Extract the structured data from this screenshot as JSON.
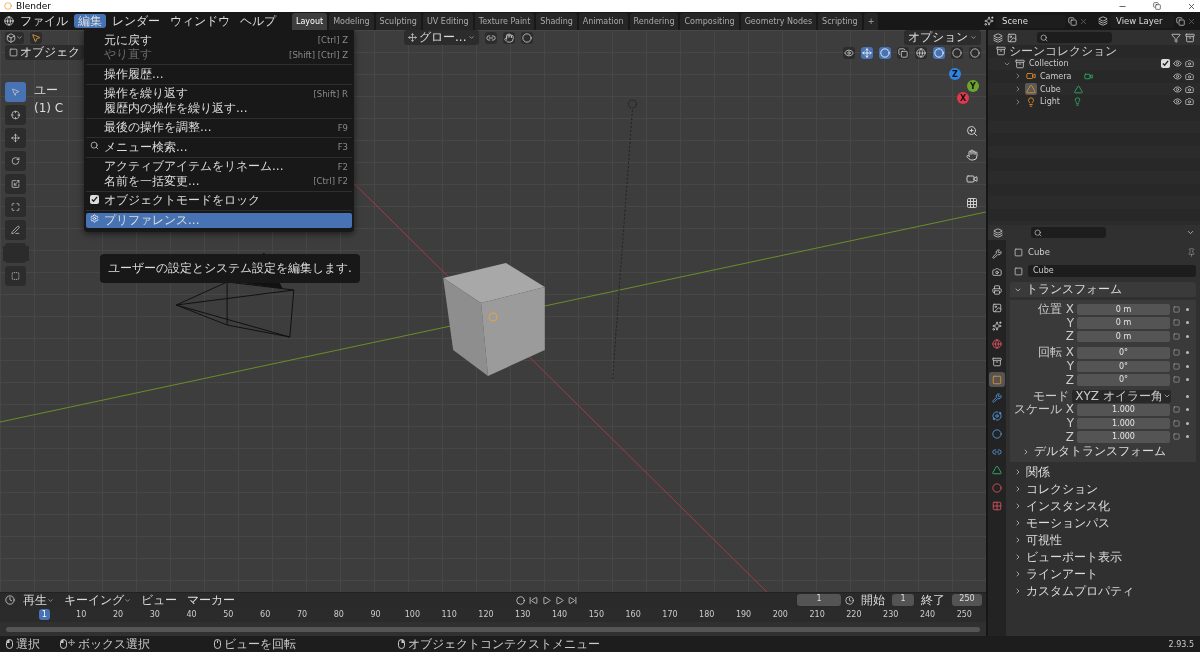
{
  "window": {
    "title": "Blender"
  },
  "menubar": [
    {
      "label": "ファイル",
      "selected": false
    },
    {
      "label": "編集",
      "selected": true
    },
    {
      "label": "レンダー",
      "selected": false
    },
    {
      "label": "ウィンドウ",
      "selected": false
    },
    {
      "label": "ヘルプ",
      "selected": false
    }
  ],
  "workspaces": [
    {
      "label": "Layout",
      "selected": true
    },
    {
      "label": "Modeling",
      "selected": false
    },
    {
      "label": "Sculpting",
      "selected": false
    },
    {
      "label": "UV Editing",
      "selected": false
    },
    {
      "label": "Texture Paint",
      "selected": false
    },
    {
      "label": "Shading",
      "selected": false
    },
    {
      "label": "Animation",
      "selected": false
    },
    {
      "label": "Rendering",
      "selected": false
    },
    {
      "label": "Compositing",
      "selected": false
    },
    {
      "label": "Geometry Nodes",
      "selected": false
    },
    {
      "label": "Scripting",
      "selected": false
    },
    {
      "label": "+",
      "selected": false
    }
  ],
  "scene": "Scene",
  "view_layer": "View Layer",
  "viewport": {
    "mode": "オブジェク",
    "orientation": "グロー...",
    "options": "オプション",
    "info": [
      "ユー",
      "(1) C"
    ],
    "tools": [
      {
        "kind": "select",
        "selected": true
      },
      {
        "kind": "cursor",
        "selected": false
      },
      {
        "kind": "move",
        "selected": false
      },
      {
        "kind": "rotate",
        "selected": false
      },
      {
        "kind": "scale",
        "selected": false
      },
      {
        "kind": "transform",
        "selected": false
      },
      {
        "kind": "annotate",
        "selected": false
      },
      {
        "kind": "measure",
        "selected": false
      },
      {
        "kind": "add",
        "selected": false
      }
    ],
    "gizmo": [
      {
        "label": "Z",
        "color": "#2f83e3"
      },
      {
        "label": "Y",
        "color": "#6ca52e"
      },
      {
        "label": "X",
        "color": "#e0384d"
      }
    ]
  },
  "edit_menu": [
    {
      "kind": "plain",
      "label": "元に戻す",
      "shortcut": "[Ctrl] Z",
      "disabled": false,
      "selected": false
    },
    {
      "kind": "plain",
      "label": "やり直す",
      "shortcut": "[Shift] [Ctrl] Z",
      "disabled": true,
      "selected": false
    },
    {
      "kind": "separator"
    },
    {
      "kind": "plain",
      "label": "操作履歴...",
      "disabled": false,
      "selected": false
    },
    {
      "kind": "separator"
    },
    {
      "kind": "plain",
      "label": "操作を繰り返す",
      "shortcut": "[Shift] R",
      "disabled": false,
      "selected": false
    },
    {
      "kind": "plain",
      "label": "履歴内の操作を繰り返す...",
      "disabled": false,
      "selected": false
    },
    {
      "kind": "separator"
    },
    {
      "kind": "plain",
      "label": "最後の操作を調整...",
      "shortcut": "F9",
      "disabled": false,
      "selected": false
    },
    {
      "kind": "separator"
    },
    {
      "kind": "search",
      "label": "メニュー検索...",
      "shortcut": "F3",
      "disabled": false,
      "selected": false
    },
    {
      "kind": "separator"
    },
    {
      "kind": "plain",
      "label": "アクティブアイテムをリネーム...",
      "shortcut": "F2",
      "disabled": false,
      "selected": false
    },
    {
      "kind": "plain",
      "label": "名前を一括変更...",
      "shortcut": "[Ctrl] F2",
      "disabled": false,
      "selected": false
    },
    {
      "kind": "separator"
    },
    {
      "kind": "checkbox",
      "label": "オブジェクトモードをロック",
      "checked": true,
      "disabled": false,
      "selected": false
    },
    {
      "kind": "separator"
    },
    {
      "kind": "settings",
      "label": "プリファレンス...",
      "disabled": false,
      "selected": true
    }
  ],
  "tooltip": "ユーザーの設定とシステム設定を編集します.",
  "outliner": {
    "root": "シーンコレクション",
    "children": [
      {
        "label": "Collection",
        "kind": "collection",
        "expanded": true,
        "checked": true,
        "children": [
          {
            "label": "Camera",
            "kind": "camera",
            "expanded": false,
            "active": false
          },
          {
            "label": "Cube",
            "kind": "mesh",
            "expanded": false,
            "active": true
          },
          {
            "label": "Light",
            "kind": "light",
            "expanded": false,
            "active": false
          }
        ]
      }
    ]
  },
  "properties": {
    "tabs": [
      {
        "kind": "tool",
        "selected": false
      },
      {
        "kind": "render",
        "selected": false
      },
      {
        "kind": "output",
        "selected": false
      },
      {
        "kind": "view_layer",
        "selected": false
      },
      {
        "kind": "scene",
        "selected": false
      },
      {
        "kind": "world",
        "selected": false
      },
      {
        "kind": "collection",
        "selected": false
      },
      {
        "kind": "object",
        "selected": true
      },
      {
        "kind": "modifiers",
        "selected": false
      },
      {
        "kind": "particles",
        "selected": false
      },
      {
        "kind": "physics",
        "selected": false
      },
      {
        "kind": "constraints",
        "selected": false
      },
      {
        "kind": "data",
        "selected": false
      },
      {
        "kind": "material",
        "selected": false
      },
      {
        "kind": "texture",
        "selected": false
      }
    ],
    "object_name": "Cube",
    "name_field": "Cube",
    "transform": {
      "title": "トランスフォーム",
      "expanded": true,
      "rows": [
        {
          "kind": "field",
          "label": "位置 X",
          "value": "0 m"
        },
        {
          "kind": "field",
          "label": "Y",
          "value": "0 m"
        },
        {
          "kind": "field",
          "label": "Z",
          "value": "0 m"
        },
        {
          "kind": "field",
          "label": "回転 X",
          "value": "0°"
        },
        {
          "kind": "field",
          "label": "Y",
          "value": "0°"
        },
        {
          "kind": "field",
          "label": "Z",
          "value": "0°"
        },
        {
          "kind": "dropdown",
          "label": "モード",
          "value": "XYZ オイラー角"
        },
        {
          "kind": "field",
          "label": "スケール X",
          "value": "1.000"
        },
        {
          "kind": "field",
          "label": "Y",
          "value": "1.000"
        },
        {
          "kind": "field",
          "label": "Z",
          "value": "1.000"
        }
      ],
      "subpanel": {
        "title": "デルタトランスフォーム",
        "expanded": false
      }
    },
    "panels": [
      {
        "title": "関係",
        "expanded": false
      },
      {
        "title": "コレクション",
        "expanded": false
      },
      {
        "title": "インスタンス化",
        "expanded": false
      },
      {
        "title": "モーションパス",
        "expanded": false
      },
      {
        "title": "可視性",
        "expanded": false
      },
      {
        "title": "ビューポート表示",
        "expanded": false
      },
      {
        "title": "ラインアート",
        "expanded": false
      },
      {
        "title": "カスタムプロパティ",
        "expanded": false
      }
    ]
  },
  "timeline": {
    "menus": [
      {
        "label": "再生",
        "dropdown": true
      },
      {
        "label": "キーイング",
        "dropdown": true
      },
      {
        "label": "ビュー",
        "dropdown": false
      },
      {
        "label": "マーカー",
        "dropdown": false
      }
    ],
    "current_frame": "1",
    "start_label": "開始",
    "start": "1",
    "end_label": "終了",
    "end": "250",
    "frames": [
      {
        "label": "1",
        "selected": true
      },
      {
        "label": "10",
        "selected": false
      },
      {
        "label": "20",
        "selected": false
      },
      {
        "label": "30",
        "selected": false
      },
      {
        "label": "40",
        "selected": false
      },
      {
        "label": "50",
        "selected": false
      },
      {
        "label": "60",
        "selected": false
      },
      {
        "label": "70",
        "selected": false
      },
      {
        "label": "80",
        "selected": false
      },
      {
        "label": "90",
        "selected": false
      },
      {
        "label": "100",
        "selected": false
      },
      {
        "label": "110",
        "selected": false
      },
      {
        "label": "120",
        "selected": false
      },
      {
        "label": "130",
        "selected": false
      },
      {
        "label": "140",
        "selected": false
      },
      {
        "label": "150",
        "selected": false
      },
      {
        "label": "160",
        "selected": false
      },
      {
        "label": "170",
        "selected": false
      },
      {
        "label": "180",
        "selected": false
      },
      {
        "label": "190",
        "selected": false
      },
      {
        "label": "200",
        "selected": false
      },
      {
        "label": "210",
        "selected": false
      },
      {
        "label": "220",
        "selected": false
      },
      {
        "label": "230",
        "selected": false
      },
      {
        "label": "240",
        "selected": false
      },
      {
        "label": "250",
        "selected": false
      }
    ]
  },
  "status_bar": {
    "items": [
      {
        "kind": "left",
        "label": "選択"
      },
      {
        "kind": "drag",
        "label": "ボックス選択"
      },
      {
        "kind": "middle",
        "label": "ビューを回転"
      },
      {
        "kind": "right",
        "label": "オブジェクトコンテクストメニュー"
      }
    ],
    "version": "2.93.5"
  }
}
